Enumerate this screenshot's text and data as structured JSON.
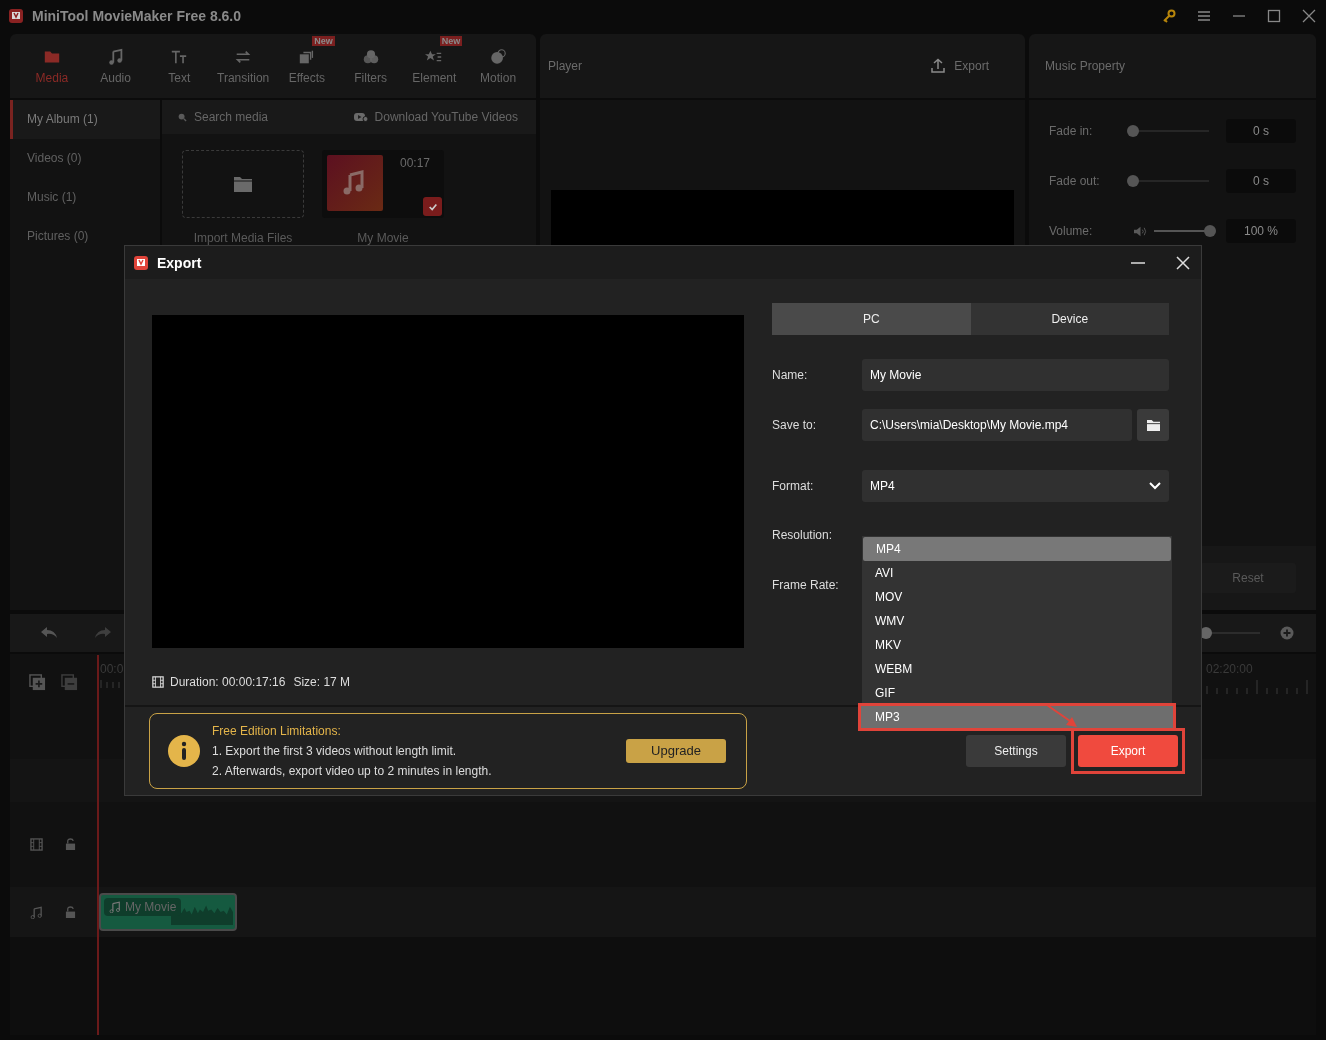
{
  "app": {
    "title": "MiniTool MovieMaker Free 8.6.0"
  },
  "toolbar_tabs": [
    {
      "label": "Media",
      "selected": true
    },
    {
      "label": "Audio",
      "selected": false
    },
    {
      "label": "Text",
      "selected": false
    },
    {
      "label": "Transition",
      "selected": false
    },
    {
      "label": "Effects",
      "selected": false,
      "badge": "New"
    },
    {
      "label": "Filters",
      "selected": false
    },
    {
      "label": "Element",
      "selected": false,
      "badge": "New"
    },
    {
      "label": "Motion",
      "selected": false
    }
  ],
  "sidebar": [
    {
      "label": "My Album (1)",
      "selected": true
    },
    {
      "label": "Videos (0)",
      "selected": false
    },
    {
      "label": "Music (1)",
      "selected": false
    },
    {
      "label": "Pictures (0)",
      "selected": false
    }
  ],
  "media": {
    "search_placeholder": "Search media",
    "download_link": "Download YouTube Videos",
    "tiles": [
      {
        "kind": "import",
        "label": "Import Media Files"
      },
      {
        "kind": "music",
        "label": "My Movie",
        "duration": "00:17",
        "checked": true
      }
    ]
  },
  "player": {
    "title": "Player",
    "export_button": "Export"
  },
  "music_property": {
    "title": "Music Property",
    "rows": [
      {
        "kind": "fade",
        "label": "Fade in:",
        "level": 0,
        "value": "0 s"
      },
      {
        "kind": "fade",
        "label": "Fade out:",
        "level": 0,
        "value": "0 s"
      },
      {
        "kind": "volume",
        "label": "Volume:",
        "level": 1,
        "value": "100 %"
      }
    ],
    "reset_button": "Reset"
  },
  "timeline": {
    "ruler_start": "00:0",
    "ruler_end": "02:20:00",
    "zoom": {
      "level": 0.55
    },
    "clip": {
      "label": "My Movie"
    }
  },
  "export_dialog": {
    "title": "Export",
    "duration_label": "Duration:",
    "duration": "00:00:17:16",
    "size_label": "Size:",
    "size": "17 M",
    "limitations": {
      "title": "Free Edition Limitations:",
      "lines": [
        "1. Export the first 3 videos without length limit.",
        "2. Afterwards, export video up to 2 minutes in length."
      ],
      "upgrade_button": "Upgrade"
    },
    "tabs": [
      {
        "label": "PC",
        "selected": true
      },
      {
        "label": "Device",
        "selected": false
      }
    ],
    "name": {
      "label": "Name:",
      "value": "My Movie"
    },
    "save_to": {
      "label": "Save to:",
      "value": "C:\\Users\\mia\\Desktop\\My Movie.mp4"
    },
    "format": {
      "label": "Format:",
      "value": "MP4",
      "expanded": true,
      "options": [
        {
          "label": "MP4",
          "selected": true,
          "outlined": false
        },
        {
          "label": "AVI",
          "selected": false,
          "outlined": false
        },
        {
          "label": "MOV",
          "selected": false,
          "outlined": false
        },
        {
          "label": "WMV",
          "selected": false,
          "outlined": false
        },
        {
          "label": "MKV",
          "selected": false,
          "outlined": false
        },
        {
          "label": "WEBM",
          "selected": false,
          "outlined": false
        },
        {
          "label": "GIF",
          "selected": false,
          "outlined": false
        },
        {
          "label": "MP3",
          "selected": false,
          "outlined": true
        }
      ]
    },
    "resolution_label": "Resolution:",
    "frame_rate_label": "Frame Rate:",
    "settings_button": "Settings",
    "export_button": {
      "label": "Export",
      "outlined": true
    }
  }
}
